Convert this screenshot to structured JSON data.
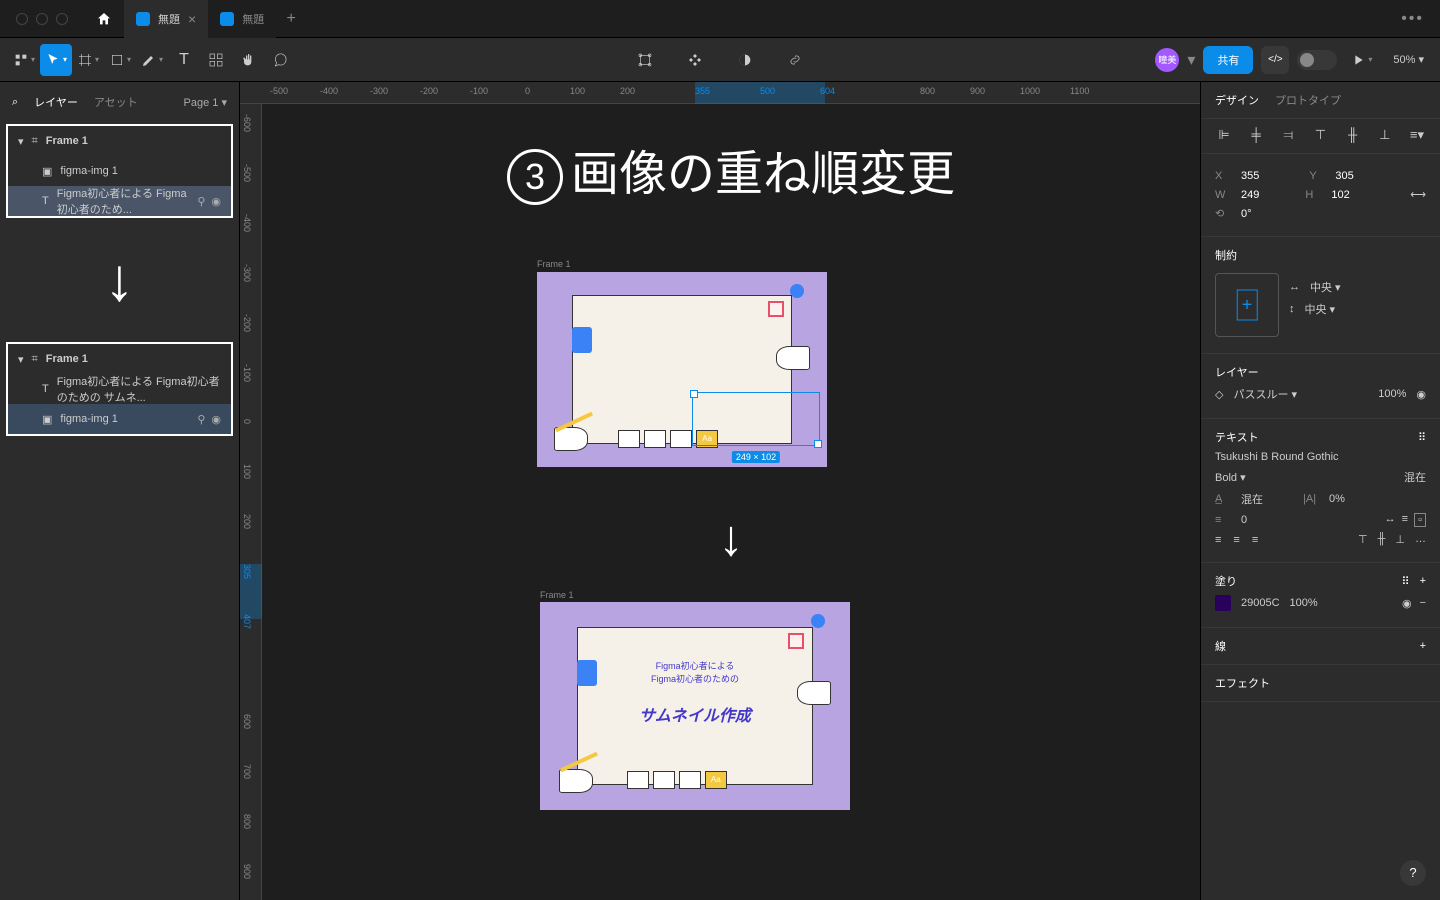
{
  "tabs": {
    "t1": "無題",
    "t2": "無題"
  },
  "toolbar": {
    "share": "共有",
    "zoom": "50%"
  },
  "leftPanel": {
    "layers": "レイヤー",
    "assets": "アセット",
    "page": "Page 1",
    "frame1": "Frame 1",
    "img": "figma-img 1",
    "text": "Figma初心者による Figma初心者のため...",
    "text2": "Figma初心者による Figma初心者のための サムネ..."
  },
  "ruler": {
    "h": {
      "m500": "-500",
      "m400": "-400",
      "m300": "-300",
      "m200": "-200",
      "m100": "-100",
      "z": "0",
      "p100": "100",
      "p200": "200",
      "p355": "355",
      "p500": "500",
      "p604": "604",
      "p800": "800",
      "p900": "900",
      "p1000": "1000",
      "p1100": "1100"
    },
    "v": {
      "m600": "-600",
      "m500": "-500",
      "m400": "-400",
      "m300": "-300",
      "m200": "-200",
      "m100": "-100",
      "z": "0",
      "p100": "100",
      "p200": "200",
      "p305": "305",
      "p407": "407",
      "p600": "600",
      "p700": "700",
      "p800": "800",
      "p900": "900"
    }
  },
  "canvas": {
    "title": "画像の重ね順変更",
    "titleNum": "3",
    "frameLabel": "Frame 1",
    "selDim": "249 × 102",
    "thumbText1": "Figma初心者による",
    "thumbText2": "Figma初心者のための",
    "thumbBig": "サムネイル作成",
    "aa": "Aa"
  },
  "design": {
    "tabDesign": "デザイン",
    "tabProto": "プロトタイプ",
    "x": "355",
    "y": "305",
    "w": "249",
    "h": "102",
    "rot": "0°",
    "constraints": "制約",
    "center": "中央",
    "layer": "レイヤー",
    "passThrough": "パススルー",
    "opacity": "100%",
    "text": "テキスト",
    "font": "Tsukushi B Round Gothic",
    "weight": "Bold",
    "mixed": "混在",
    "letterSpacing": "0%",
    "lineHeight": "0",
    "fill": "塗り",
    "fillHex": "29005C",
    "fillOp": "100%",
    "stroke": "線",
    "effects": "エフェクト"
  }
}
